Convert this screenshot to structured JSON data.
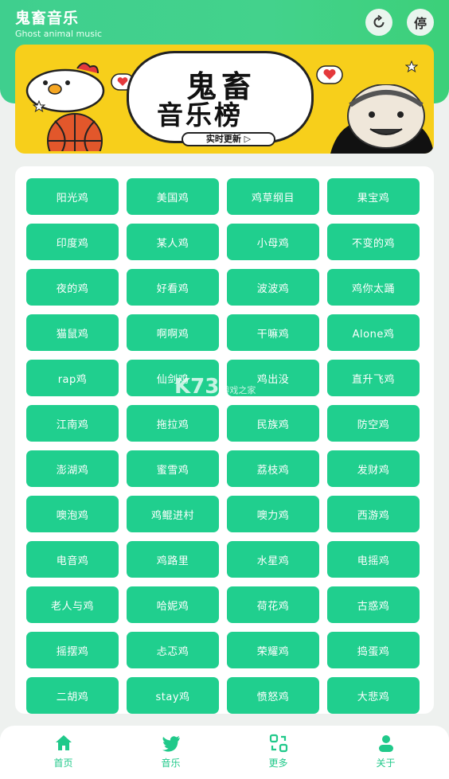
{
  "header": {
    "title": "鬼畜音乐",
    "subtitle": "Ghost animal music",
    "stop_label": "停"
  },
  "banner": {
    "title_line1": "鬼畜",
    "title_line2": "音乐榜",
    "tag": "实时更新 ▷"
  },
  "items": [
    "阳光鸡",
    "美国鸡",
    "鸡草纲目",
    "果宝鸡",
    "印度鸡",
    "某人鸡",
    "小母鸡",
    "不变的鸡",
    "夜的鸡",
    "好看鸡",
    "波波鸡",
    "鸡你太踊",
    "猫鼠鸡",
    "啊啊鸡",
    "干嘛鸡",
    "Alone鸡",
    "rap鸡",
    "仙剑鸡",
    "鸡出没",
    "直升飞鸡",
    "江南鸡",
    "拖拉鸡",
    "民族鸡",
    "防空鸡",
    "澎湖鸡",
    "蜜雪鸡",
    "荔枝鸡",
    "发财鸡",
    "噢泡鸡",
    "鸡鲲进村",
    "噢力鸡",
    "西游鸡",
    "电音鸡",
    "鸡路里",
    "水星鸡",
    "电摇鸡",
    "老人与鸡",
    "哈妮鸡",
    "荷花鸡",
    "古惑鸡",
    "摇摆鸡",
    "忐忑鸡",
    "荣耀鸡",
    "捣蛋鸡",
    "二胡鸡",
    "stay鸡",
    "愤怒鸡",
    "大悲鸡"
  ],
  "watermark": {
    "main": "K73",
    "sub": "游戏之家"
  },
  "nav": [
    {
      "label": "首页",
      "icon": "home-icon"
    },
    {
      "label": "音乐",
      "icon": "twitter-bird-icon"
    },
    {
      "label": "更多",
      "icon": "more-apps-icon"
    },
    {
      "label": "关于",
      "icon": "user-icon"
    }
  ],
  "colors": {
    "accent": "#20cf8e",
    "header": "#43d28c",
    "banner": "#f7cf1b"
  }
}
